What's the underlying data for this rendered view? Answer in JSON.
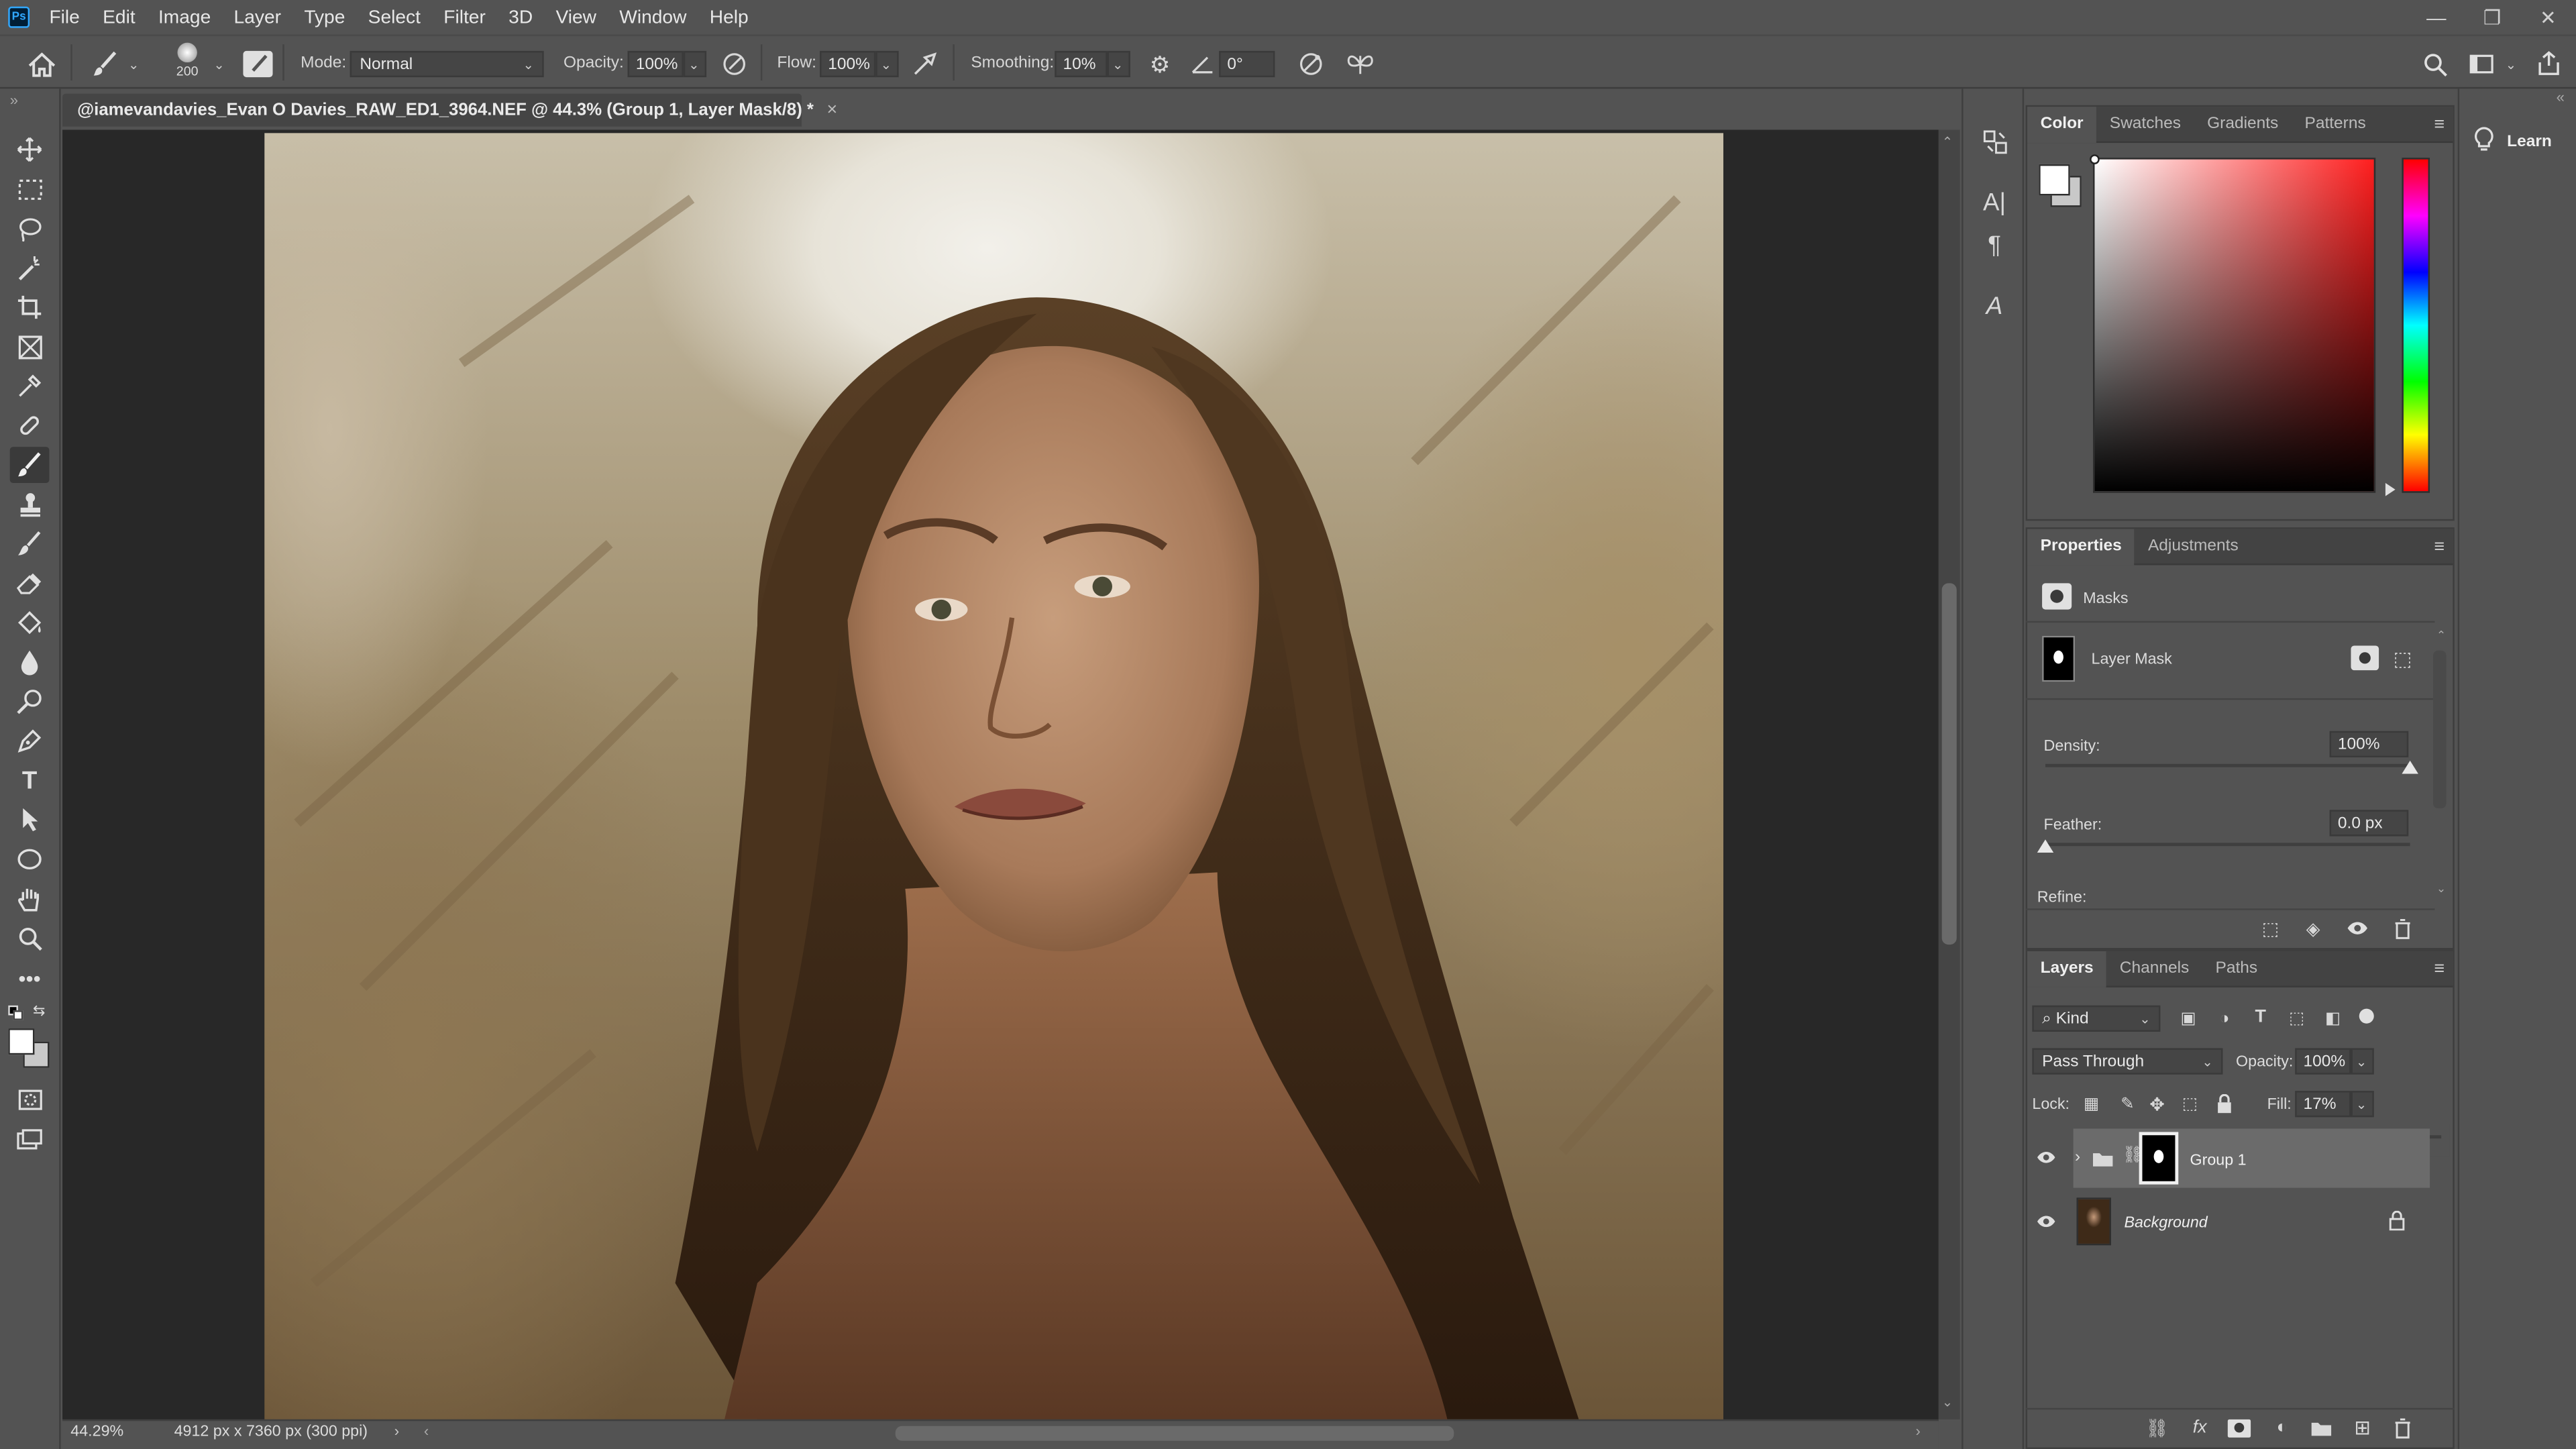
{
  "app": {
    "logo": "Ps"
  },
  "menu": [
    "File",
    "Edit",
    "Image",
    "Layer",
    "Type",
    "Select",
    "Filter",
    "3D",
    "View",
    "Window",
    "Help"
  ],
  "window_controls": {
    "minimize": "—",
    "restore": "❐",
    "close": "✕"
  },
  "options": {
    "brush_size": "200",
    "mode_label": "Mode:",
    "mode_value": "Normal",
    "opacity_label": "Opacity:",
    "opacity_value": "100%",
    "flow_label": "Flow:",
    "flow_value": "100%",
    "smoothing_label": "Smoothing:",
    "smoothing_value": "10%",
    "angle_value": "0°"
  },
  "document": {
    "tab_title": "@iamevandavies_Evan O Davies_RAW_ED1_3964.NEF @ 44.3% (Group 1, Layer Mask/8) *",
    "close": "×"
  },
  "status": {
    "zoom": "44.29%",
    "size": "4912 px x 7360 px (300 ppi)"
  },
  "learn": {
    "label": "Learn"
  },
  "color_panel": {
    "tabs": [
      "Color",
      "Swatches",
      "Gradients",
      "Patterns"
    ],
    "foreground": "#ffffff",
    "background": "#c8c8c8"
  },
  "properties_panel": {
    "tabs": [
      "Properties",
      "Adjustments"
    ],
    "section": "Masks",
    "mask_label": "Layer Mask",
    "density_label": "Density:",
    "density_value": "100%",
    "density_level": 1.0,
    "feather_label": "Feather:",
    "feather_value": "0.0 px",
    "feather_level": 0.0,
    "refine_label": "Refine:"
  },
  "layers_panel": {
    "tabs": [
      "Layers",
      "Channels",
      "Paths"
    ],
    "filter_kind": "Kind",
    "blend_mode": "Pass Through",
    "opacity_label": "Opacity:",
    "opacity_value": "100%",
    "lock_label": "Lock:",
    "fill_label": "Fill:",
    "fill_value": "17%",
    "fill_level": 0.17,
    "layers": [
      {
        "name": "Group 1",
        "selected": true
      },
      {
        "name": "Background",
        "selected": false
      }
    ]
  }
}
